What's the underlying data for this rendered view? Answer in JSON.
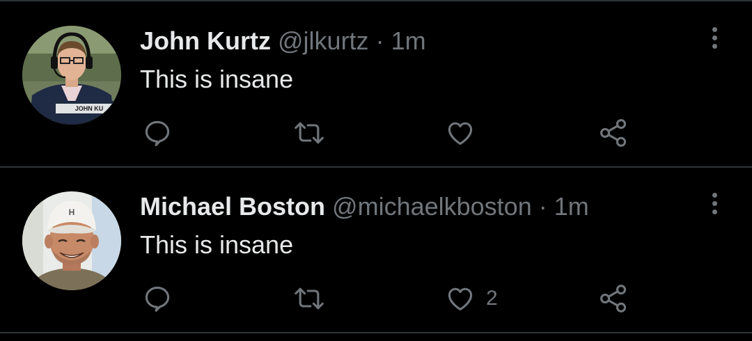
{
  "colors": {
    "background": "#000000",
    "primary_text": "#e7e9ea",
    "secondary_text": "#71767b",
    "divider": "#2f3336"
  },
  "tweets": [
    {
      "name": "John Kurtz",
      "handle": "@jlkurtz",
      "separator": "·",
      "time": "1m",
      "text": "This is insane",
      "avatar_caption": "JOHN KU",
      "like_count": "",
      "icons": [
        "reply-icon",
        "retweet-icon",
        "like-icon",
        "share-icon",
        "more-icon"
      ]
    },
    {
      "name": "Michael Boston",
      "handle": "@michaelkboston",
      "separator": "·",
      "time": "1m",
      "text": "This is insane",
      "like_count": "2",
      "icons": [
        "reply-icon",
        "retweet-icon",
        "like-icon",
        "share-icon",
        "more-icon"
      ]
    }
  ]
}
